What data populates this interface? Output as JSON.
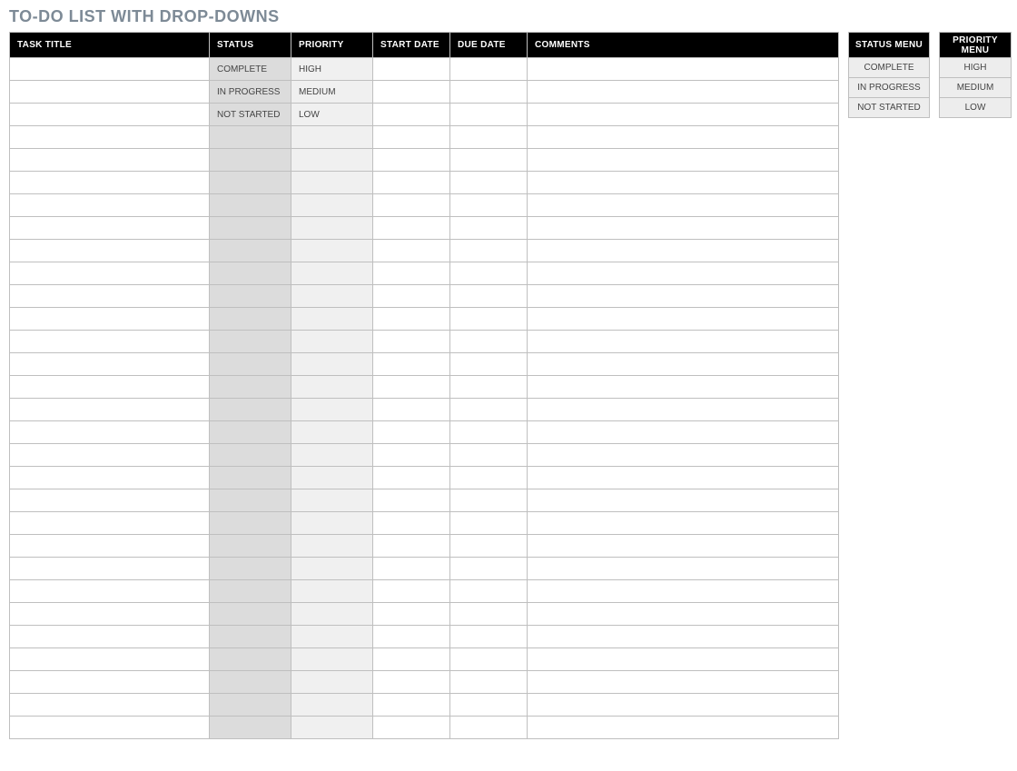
{
  "title": "TO-DO LIST WITH DROP-DOWNS",
  "columns": {
    "task_title": "TASK TITLE",
    "status": "STATUS",
    "priority": "PRIORITY",
    "start_date": "START DATE",
    "due_date": "DUE DATE",
    "comments": "COMMENTS"
  },
  "rows": [
    {
      "task_title": "",
      "status": "COMPLETE",
      "priority": "HIGH",
      "start_date": "",
      "due_date": "",
      "comments": ""
    },
    {
      "task_title": "",
      "status": "IN PROGRESS",
      "priority": "MEDIUM",
      "start_date": "",
      "due_date": "",
      "comments": ""
    },
    {
      "task_title": "",
      "status": "NOT STARTED",
      "priority": "LOW",
      "start_date": "",
      "due_date": "",
      "comments": ""
    },
    {
      "task_title": "",
      "status": "",
      "priority": "",
      "start_date": "",
      "due_date": "",
      "comments": ""
    },
    {
      "task_title": "",
      "status": "",
      "priority": "",
      "start_date": "",
      "due_date": "",
      "comments": ""
    },
    {
      "task_title": "",
      "status": "",
      "priority": "",
      "start_date": "",
      "due_date": "",
      "comments": ""
    },
    {
      "task_title": "",
      "status": "",
      "priority": "",
      "start_date": "",
      "due_date": "",
      "comments": ""
    },
    {
      "task_title": "",
      "status": "",
      "priority": "",
      "start_date": "",
      "due_date": "",
      "comments": ""
    },
    {
      "task_title": "",
      "status": "",
      "priority": "",
      "start_date": "",
      "due_date": "",
      "comments": ""
    },
    {
      "task_title": "",
      "status": "",
      "priority": "",
      "start_date": "",
      "due_date": "",
      "comments": ""
    },
    {
      "task_title": "",
      "status": "",
      "priority": "",
      "start_date": "",
      "due_date": "",
      "comments": ""
    },
    {
      "task_title": "",
      "status": "",
      "priority": "",
      "start_date": "",
      "due_date": "",
      "comments": ""
    },
    {
      "task_title": "",
      "status": "",
      "priority": "",
      "start_date": "",
      "due_date": "",
      "comments": ""
    },
    {
      "task_title": "",
      "status": "",
      "priority": "",
      "start_date": "",
      "due_date": "",
      "comments": ""
    },
    {
      "task_title": "",
      "status": "",
      "priority": "",
      "start_date": "",
      "due_date": "",
      "comments": ""
    },
    {
      "task_title": "",
      "status": "",
      "priority": "",
      "start_date": "",
      "due_date": "",
      "comments": ""
    },
    {
      "task_title": "",
      "status": "",
      "priority": "",
      "start_date": "",
      "due_date": "",
      "comments": ""
    },
    {
      "task_title": "",
      "status": "",
      "priority": "",
      "start_date": "",
      "due_date": "",
      "comments": ""
    },
    {
      "task_title": "",
      "status": "",
      "priority": "",
      "start_date": "",
      "due_date": "",
      "comments": ""
    },
    {
      "task_title": "",
      "status": "",
      "priority": "",
      "start_date": "",
      "due_date": "",
      "comments": ""
    },
    {
      "task_title": "",
      "status": "",
      "priority": "",
      "start_date": "",
      "due_date": "",
      "comments": ""
    },
    {
      "task_title": "",
      "status": "",
      "priority": "",
      "start_date": "",
      "due_date": "",
      "comments": ""
    },
    {
      "task_title": "",
      "status": "",
      "priority": "",
      "start_date": "",
      "due_date": "",
      "comments": ""
    },
    {
      "task_title": "",
      "status": "",
      "priority": "",
      "start_date": "",
      "due_date": "",
      "comments": ""
    },
    {
      "task_title": "",
      "status": "",
      "priority": "",
      "start_date": "",
      "due_date": "",
      "comments": ""
    },
    {
      "task_title": "",
      "status": "",
      "priority": "",
      "start_date": "",
      "due_date": "",
      "comments": ""
    },
    {
      "task_title": "",
      "status": "",
      "priority": "",
      "start_date": "",
      "due_date": "",
      "comments": ""
    },
    {
      "task_title": "",
      "status": "",
      "priority": "",
      "start_date": "",
      "due_date": "",
      "comments": ""
    },
    {
      "task_title": "",
      "status": "",
      "priority": "",
      "start_date": "",
      "due_date": "",
      "comments": ""
    },
    {
      "task_title": "",
      "status": "",
      "priority": "",
      "start_date": "",
      "due_date": "",
      "comments": ""
    }
  ],
  "status_menu": {
    "header": "STATUS MENU",
    "items": [
      "COMPLETE",
      "IN PROGRESS",
      "NOT STARTED"
    ]
  },
  "priority_menu": {
    "header": "PRIORITY MENU",
    "items": [
      "HIGH",
      "MEDIUM",
      "LOW"
    ]
  }
}
